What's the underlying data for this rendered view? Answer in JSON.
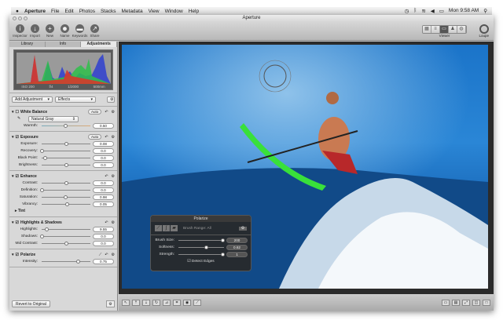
{
  "menubar": {
    "apple": "",
    "app": "Aperture",
    "items": [
      "File",
      "Edit",
      "Photos",
      "Stacks",
      "Metadata",
      "View",
      "Window",
      "Help"
    ],
    "clock": "Mon 9:58 AM",
    "status_icons": [
      "time-machine-icon",
      "bluetooth-icon",
      "wifi-icon",
      "volume-icon",
      "battery-icon",
      "spotlight-icon"
    ]
  },
  "window": {
    "title": "Aperture"
  },
  "toolbar": {
    "buttons": [
      {
        "label": "Inspector",
        "icon": "i"
      },
      {
        "label": "Import",
        "icon": "↓"
      },
      {
        "label": "New",
        "icon": "+"
      },
      {
        "label": "Name",
        "icon": "☻"
      },
      {
        "label": "Keywords",
        "icon": "▬"
      },
      {
        "label": "Share",
        "icon": "↗"
      }
    ],
    "viewer_label": "Viewer",
    "loupe_label": "Loupe"
  },
  "sidebar": {
    "tabs": [
      "Library",
      "Info",
      "Adjustments"
    ],
    "histogram": {
      "iso": "ISO 200",
      "aperture": "f/4",
      "shutter": "1/2000",
      "focal": "500mm"
    },
    "add_adjustment": "Add Adjustment",
    "effects": "Effects",
    "white_balance": {
      "title": "White Balance",
      "auto": "Auto",
      "preset": "Natural Gray",
      "warmth_label": "Warmth:",
      "warmth": "0.50"
    },
    "exposure": {
      "title": "Exposure",
      "auto": "Auto",
      "rows": [
        {
          "label": "Exposure:",
          "value": "0.08",
          "pos": 0.5
        },
        {
          "label": "Recovery:",
          "value": "0.0",
          "pos": 0
        },
        {
          "label": "Black Point:",
          "value": "0.0",
          "pos": 0.08
        },
        {
          "label": "Brightness:",
          "value": "0.0",
          "pos": 0.5
        }
      ]
    },
    "enhance": {
      "title": "Enhance",
      "rows": [
        {
          "label": "Contrast:",
          "value": "0.0",
          "pos": 0.5
        },
        {
          "label": "Definition:",
          "value": "0.0",
          "pos": 0
        },
        {
          "label": "Saturation:",
          "value": "0.98",
          "pos": 0.49
        },
        {
          "label": "Vibrancy:",
          "value": "0.05",
          "pos": 0.52
        }
      ],
      "tint": "Tint"
    },
    "highlights": {
      "title": "Highlights & Shadows",
      "rows": [
        {
          "label": "Highlights:",
          "value": "9.55",
          "pos": 0.1
        },
        {
          "label": "Shadows:",
          "value": "0.0",
          "pos": 0
        },
        {
          "label": "Mid Contrast:",
          "value": "0.0",
          "pos": 0.5
        }
      ]
    },
    "polarize": {
      "title": "Polarize",
      "rows": [
        {
          "label": "Intensity:",
          "value": "0.75",
          "pos": 0.75
        }
      ]
    },
    "revert": "Revert to Original"
  },
  "hud": {
    "title": "Polarize",
    "brush_range": "Brush Range: All",
    "rows": [
      {
        "label": "Brush Size:",
        "value": "200",
        "pos": 0.98
      },
      {
        "label": "Softness:",
        "value": "0.62",
        "pos": 0.62
      },
      {
        "label": "Strength:",
        "value": "1",
        "pos": 0.98
      }
    ],
    "detect_edges": "Detect Edges"
  }
}
